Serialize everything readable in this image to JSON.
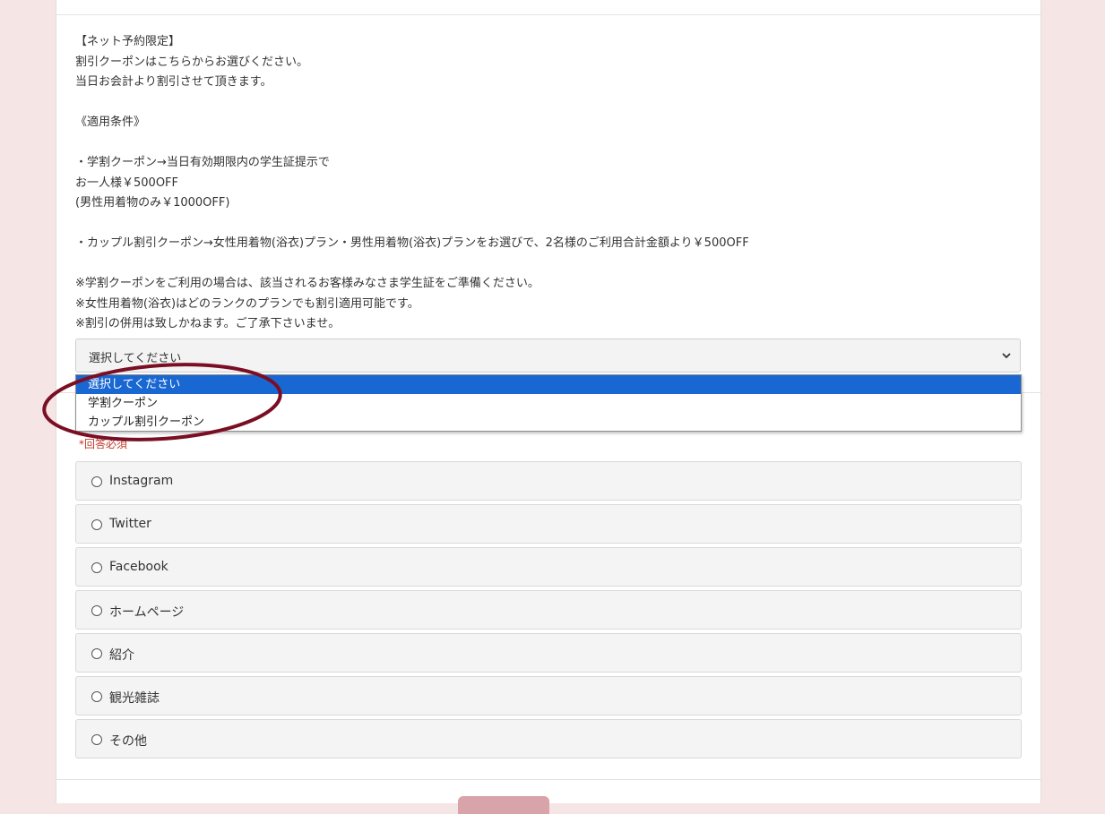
{
  "notice": {
    "lines": [
      "【ネット予約限定】",
      "割引クーポンはこちらからお選びください。",
      "当日お会計より割引させて頂きます。",
      "",
      "《適用条件》",
      "",
      "・学割クーポン→当日有効期限内の学生証提示で",
      "お一人様￥500OFF",
      "(男性用着物のみ￥1000OFF)",
      "",
      "・カップル割引クーポン→女性用着物(浴衣)プラン・男性用着物(浴衣)プランをお選びで、2名様のご利用合計金額より￥500OFF",
      "",
      "※学割クーポンをご利用の場合は、該当されるお客様みなさま学生証をご準備ください。",
      "※女性用着物(浴衣)はどのランクのプランでも割引適用可能です。",
      "※割引の併用は致しかねます。ご了承下さいませ。"
    ]
  },
  "coupon_select": {
    "value": "選択してください",
    "options": [
      "選択してください",
      "学割クーポン",
      "カップル割引クーポン"
    ],
    "selected_index": 0
  },
  "referral": {
    "required_label": "*回答必須",
    "options": [
      "Instagram",
      "Twitter",
      "Facebook",
      "ホームページ",
      "紹介",
      "観光雑誌",
      "その他"
    ]
  },
  "colors": {
    "page_bg": "#f6e5e5",
    "selected_option": "#1967d2",
    "annotation_ellipse": "#7a0f24",
    "required": "#c0392b",
    "submit": "#d9a4a9"
  }
}
